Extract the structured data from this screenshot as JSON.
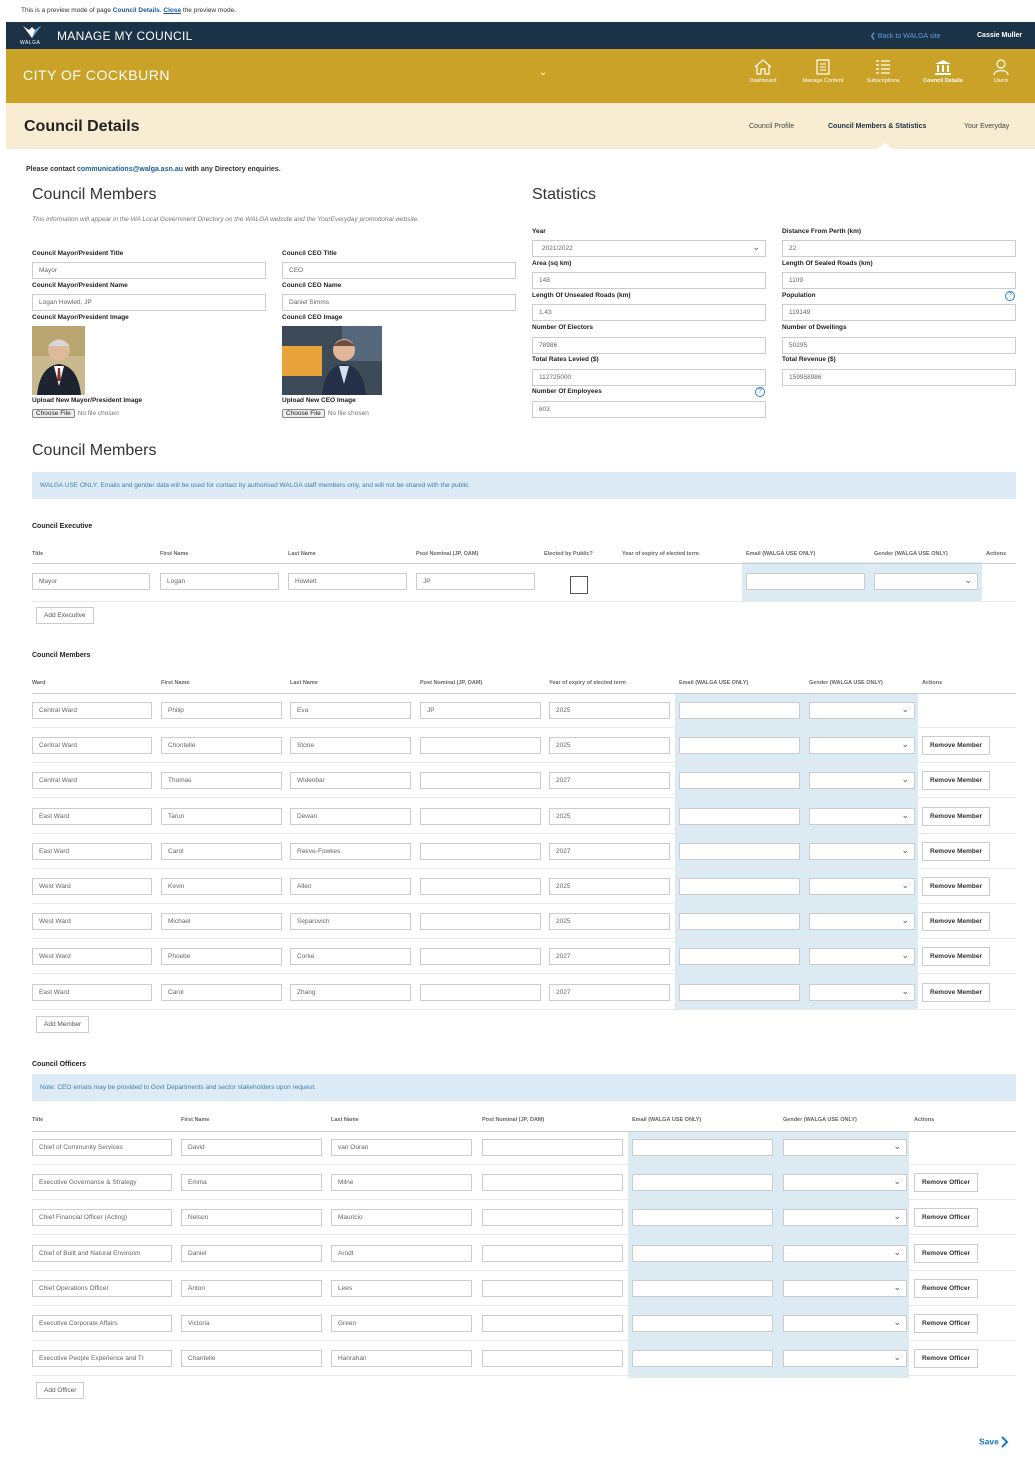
{
  "preview": {
    "text1": "This is a preview mode of page ",
    "page": "Council Details",
    "close": "Close",
    "text2": " the preview mode."
  },
  "topbar": {
    "logo": "WALGA",
    "app": "MANAGE MY COUNCIL",
    "back": "❮ Back to WALGA site",
    "user": "Cassie Muller"
  },
  "goldbar": {
    "council": "CITY OF COCKBURN",
    "chevron": "⌄",
    "nav": [
      {
        "label": "Dashboard",
        "icon": "home-icon"
      },
      {
        "label": "Manage Content",
        "icon": "document-icon"
      },
      {
        "label": "Subscriptions",
        "icon": "list-icon"
      },
      {
        "label": "Council Details",
        "icon": "building-icon",
        "active": true
      },
      {
        "label": "Users",
        "icon": "user-icon"
      }
    ]
  },
  "page": {
    "title": "Council Details",
    "tabs": [
      "Council Profile",
      "Council Members & Statistics",
      "Your Everyday"
    ]
  },
  "contact": {
    "prefix": "Please contact ",
    "email": "communications@walga.asn.au",
    "suffix": " with any Directory enquiries."
  },
  "members_section": {
    "heading": "Council Members",
    "note": "This information will appear in the WA Local Government Directory on the WALGA website and the YourEveryday promotional website.",
    "mayor_title_label": "Council Mayor/President Title",
    "mayor_title": "Mayor",
    "mayor_name_label": "Council Mayor/President Name",
    "mayor_name": "Logan Howlett, JP",
    "mayor_image_label": "Council Mayor/President Image",
    "mayor_upload_label": "Upload New Mayor/President Image",
    "ceo_title_label": "Council CEO Title",
    "ceo_title": "CEO",
    "ceo_name_label": "Council CEO Name",
    "ceo_name": "Daniel Simms",
    "ceo_image_label": "Council CEO Image",
    "ceo_upload_label": "Upload New CEO Image",
    "choose_file": "Choose File",
    "no_file": "No file chosen"
  },
  "statistics": {
    "heading": "Statistics",
    "year_label": "Year",
    "year": "2021/2022",
    "distance_label": "Distance From Perth (km)",
    "distance": "22",
    "area_label": "Area (sq km)",
    "area": "148",
    "sealed_label": "Length Of Sealed Roads (km)",
    "sealed": "1109",
    "unsealed_label": "Length Of Unsealed Roads (km)",
    "unsealed": "1.43",
    "population_label": "Population",
    "population": "119149",
    "electors_label": "Number Of Electors",
    "electors": "78986",
    "dwellings_label": "Number of Dwellings",
    "dwellings": "50295",
    "rates_label": "Total Rates Levied ($)",
    "rates": "112725000",
    "revenue_label": "Total Revenue ($)",
    "revenue": "159958986",
    "employees_label": "Number Of Employees",
    "employees": "603",
    "help": "?"
  },
  "members_table_section": {
    "heading": "Council Members",
    "notice": "WALGA USE ONLY: Emails and gender data will be used for contact by authorised WALGA staff members only, and will not be shared with the public."
  },
  "executive": {
    "label": "Council Executive",
    "headers": [
      "Title",
      "First Name",
      "Last Name",
      "Post Nominal (JP, OAM)",
      "Elected by Public?",
      "Year of expiry of elected term",
      "Email (WALGA USE ONLY)",
      "Gender (WALGA USE ONLY)",
      "Actions"
    ],
    "row": {
      "title": "Mayor",
      "first": "Logan",
      "last": "Howlett",
      "post": "JP"
    },
    "add": "Add Executive"
  },
  "members": {
    "label": "Council Members",
    "headers": [
      "Ward",
      "First Name",
      "Last Name",
      "Post Nominal (JP, OAM)",
      "Year of expiry of elected term",
      "Email (WALGA USE ONLY)",
      "Gender (WALGA USE ONLY)",
      "Actions"
    ],
    "rows": [
      {
        "ward": "Central Ward",
        "first": "Philip",
        "last": "Eva",
        "post": "JP",
        "year": "2025",
        "remove": ""
      },
      {
        "ward": "Central Ward",
        "first": "Chontelle",
        "last": "Stone",
        "post": "",
        "year": "2025",
        "remove": "Remove Member"
      },
      {
        "ward": "Central Ward",
        "first": "Thomas",
        "last": "Widenbar",
        "post": "",
        "year": "2027",
        "remove": "Remove Member"
      },
      {
        "ward": "East Ward",
        "first": "Tarun",
        "last": "Dewan",
        "post": "",
        "year": "2025",
        "remove": "Remove Member"
      },
      {
        "ward": "East Ward",
        "first": "Carol",
        "last": "Reeve-Fowkes",
        "post": "",
        "year": "2027",
        "remove": "Remove Member"
      },
      {
        "ward": "West Ward",
        "first": "Kevin",
        "last": "Allen",
        "post": "",
        "year": "2025",
        "remove": "Remove Member"
      },
      {
        "ward": "West Ward",
        "first": "Michael",
        "last": "Separovich",
        "post": "",
        "year": "2025",
        "remove": "Remove Member"
      },
      {
        "ward": "West Ward",
        "first": "Phoebe",
        "last": "Corke",
        "post": "",
        "year": "2027",
        "remove": "Remove Member"
      },
      {
        "ward": "East Ward",
        "first": "Carol",
        "last": "Zhang",
        "post": "",
        "year": "2027",
        "remove": "Remove Member"
      }
    ],
    "add": "Add Member"
  },
  "officers": {
    "label": "Council Officers",
    "note": "Note: CEO emails may be provided to Govt Departments and sector stakeholders upon request.",
    "headers": [
      "Title",
      "First Name",
      "Last Name",
      "Post Nominal (JP, OAM)",
      "Email (WALGA USE ONLY)",
      "Gender (WALGA USE ONLY)",
      "Actions"
    ],
    "rows": [
      {
        "title": "Chief of Community Services",
        "first": "David",
        "last": "van Ooran",
        "remove": ""
      },
      {
        "title": "Executive Governance & Strategy",
        "first": "Emma",
        "last": "Milne",
        "remove": "Remove Officer"
      },
      {
        "title": "Chief Financial Officer (Acting)",
        "first": "Nelson",
        "last": "Mauricio",
        "remove": "Remove Officer"
      },
      {
        "title": "Chief of Built and Natural Environm",
        "first": "Daniel",
        "last": "Arndt",
        "remove": "Remove Officer"
      },
      {
        "title": "Chief Operations Officer",
        "first": "Anton",
        "last": "Lees",
        "remove": "Remove Officer"
      },
      {
        "title": "Executive Corporate Affairs",
        "first": "Victoria",
        "last": "Green",
        "remove": "Remove Officer"
      },
      {
        "title": "Executive People Experience and Tr",
        "first": "Chantelle",
        "last": "Hanrahan",
        "remove": "Remove Officer"
      }
    ],
    "add": "Add Officer"
  },
  "save": "Save"
}
